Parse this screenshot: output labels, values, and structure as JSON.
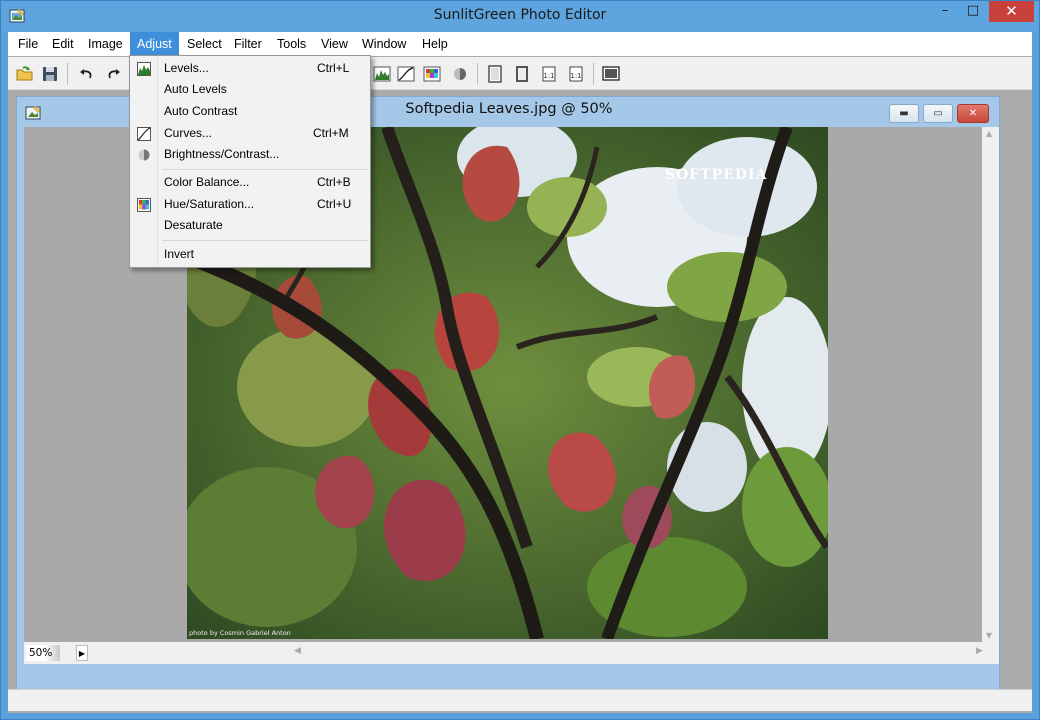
{
  "window": {
    "title": "SunlitGreen Photo Editor",
    "minimize_glyph": "–",
    "maximize_glyph": "□",
    "close_glyph": "✕"
  },
  "menubar": {
    "items": [
      "File",
      "Edit",
      "Image",
      "Adjust",
      "Select",
      "Filter",
      "Tools",
      "View",
      "Window",
      "Help"
    ],
    "active": "Adjust"
  },
  "toolbar": {
    "buttons": [
      "open-folder-icon",
      "save-icon",
      "undo-icon",
      "redo-icon",
      "levels-icon",
      "curves-icon",
      "hue-saturation-icon",
      "brightness-icon",
      "frame-icon",
      "frame-shadow-icon",
      "frame-1-icon",
      "frame-2-icon",
      "fullscreen-icon"
    ]
  },
  "document": {
    "title": "Softpedia Leaves.jpg @ 50%",
    "zoom": "50%",
    "watermark": "SOFTPEDIA",
    "credit": "photo by Cosmin Gabriel Anton"
  },
  "adjust_menu": {
    "items": [
      {
        "label": "Levels...",
        "shortcut": "Ctrl+L",
        "icon": "levels-icon"
      },
      {
        "label": "Auto Levels",
        "shortcut": "",
        "icon": ""
      },
      {
        "label": "Auto Contrast",
        "shortcut": "",
        "icon": ""
      },
      {
        "label": "Curves...",
        "shortcut": "Ctrl+M",
        "icon": "curves-icon"
      },
      {
        "label": "Brightness/Contrast...",
        "shortcut": "",
        "icon": "brightness-icon"
      },
      {
        "label": "Color Balance...",
        "shortcut": "Ctrl+B",
        "icon": ""
      },
      {
        "label": "Hue/Saturation...",
        "shortcut": "Ctrl+U",
        "icon": "hue-saturation-icon"
      },
      {
        "label": "Desaturate",
        "shortcut": "",
        "icon": ""
      },
      {
        "label": "Invert",
        "shortcut": "",
        "icon": ""
      }
    ]
  },
  "colors": {
    "title_bar": "#5ea5df",
    "menu_active": "#3c8fd8",
    "close_button": "#c7403a"
  }
}
